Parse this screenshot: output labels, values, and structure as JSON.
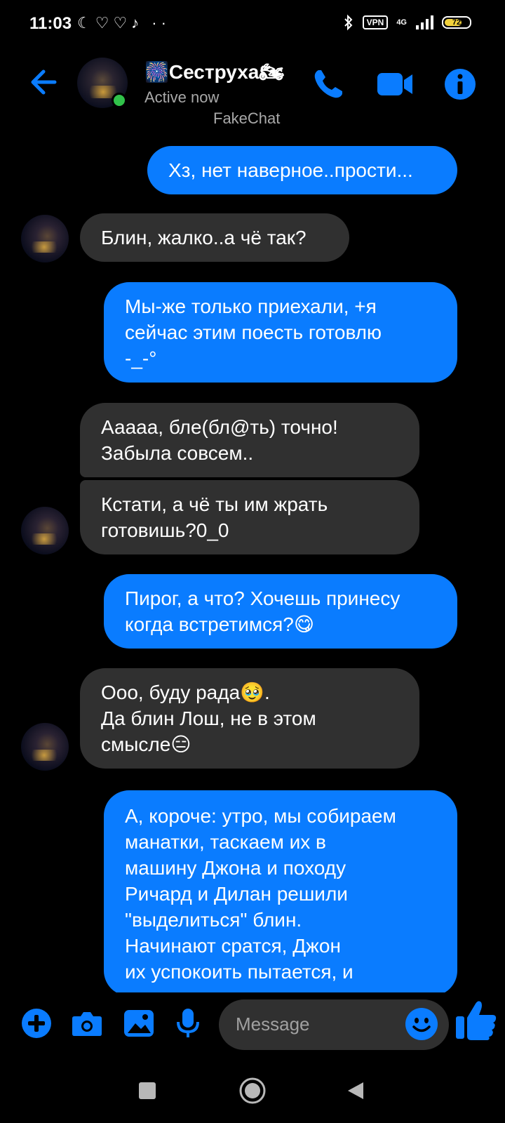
{
  "status_bar": {
    "time": "11:03",
    "left_icons": "☾♡♡♪ ··",
    "vpn_label": "VPN",
    "network_label": "4G",
    "battery_level": "72",
    "bluetooth_icon": "bluetooth-icon"
  },
  "header": {
    "contact_name": "🎆Сеструха🏍",
    "presence": "Active now",
    "watermark": "FakeChat",
    "icons": [
      "back-arrow-icon",
      "phone-icon",
      "video-camera-icon",
      "info-icon"
    ]
  },
  "messages": [
    {
      "side": "out",
      "text": "Хз, нет наверное..прости..."
    },
    {
      "side": "in",
      "text": "Блин, жалко..а чё так?"
    },
    {
      "side": "out",
      "text": "Мы-же только приехали, +я\nсейчас этим поесть готовлю\n-_-°"
    },
    {
      "side": "in",
      "text": "Ааааа, бле(бл@ть) точно!\nЗабыла совсем.."
    },
    {
      "side": "in",
      "text": "Кстати, а чё ты им жрать\nготовишь?0_0"
    },
    {
      "side": "out",
      "text": "Пирог, а что? Хочешь принесу\nкогда встретимся?😋"
    },
    {
      "side": "in",
      "text": "Ооо, буду рада🥹.\nДа блин Лош, не в этом\nсмысле😑"
    },
    {
      "side": "out",
      "text": "А, короче: утро, мы собираем\nманатки, таскаем их в\nмашину Джона и походу\nРичард и Дилан решили\n\"выделиться\" блин.\nНачинают сратся, Джон\nих успокоить пытается, и"
    }
  ],
  "composer": {
    "placeholder": "Message",
    "icons": [
      "plus-icon",
      "camera-icon",
      "gallery-icon",
      "microphone-icon",
      "emoji-icon",
      "thumbs-up-icon"
    ]
  },
  "colors": {
    "accent": "#0a7cff",
    "incoming_bubble": "#303030",
    "background": "#000000",
    "online_dot": "#31c24a"
  }
}
